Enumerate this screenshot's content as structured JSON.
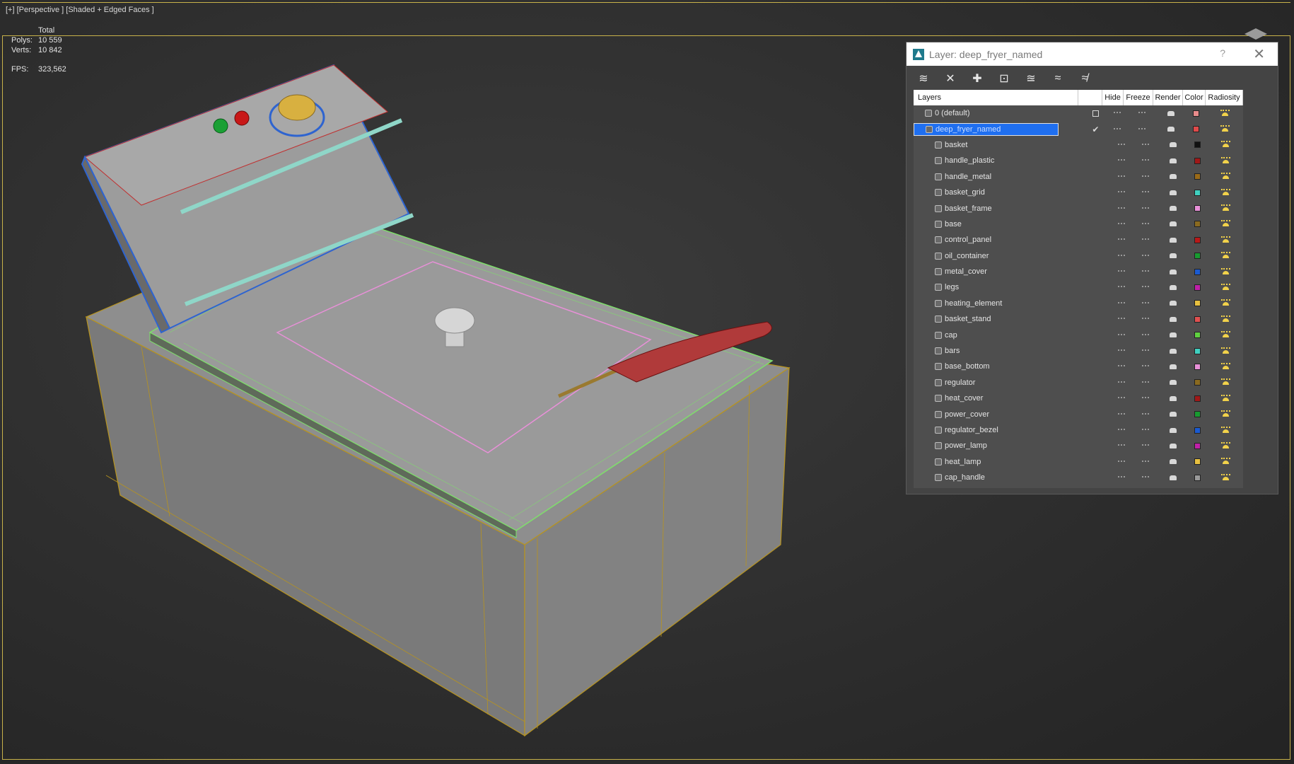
{
  "viewport": {
    "label": "[+] [Perspective ] [Shaded + Edged Faces ]",
    "stats": {
      "total_label": "Total",
      "polys_label": "Polys:",
      "polys_value": "10 559",
      "verts_label": "Verts:",
      "verts_value": "10 842",
      "fps_label": "FPS:",
      "fps_value": "323,562"
    }
  },
  "dialog": {
    "title": "Layer: deep_fryer_named",
    "help": "?",
    "close": "✕",
    "columns": {
      "layers": "Layers",
      "hide": "Hide",
      "freeze": "Freeze",
      "render": "Render",
      "color": "Color",
      "radiosity": "Radiosity"
    },
    "layers": [
      {
        "name": "0 (default)",
        "level": 0,
        "color": "#e88c8c",
        "checkbox": true
      },
      {
        "name": "deep_fryer_named",
        "level": 0,
        "color": "#e04a4a",
        "selected": true,
        "active": true
      },
      {
        "name": "basket",
        "level": 1,
        "color": "#111111"
      },
      {
        "name": "handle_plastic",
        "level": 1,
        "color": "#a01818"
      },
      {
        "name": "handle_metal",
        "level": 1,
        "color": "#9a6a18"
      },
      {
        "name": "basket_grid",
        "level": 1,
        "color": "#40d0c0"
      },
      {
        "name": "basket_frame",
        "level": 1,
        "color": "#e890d8"
      },
      {
        "name": "base",
        "level": 1,
        "color": "#8a6a20"
      },
      {
        "name": "control_panel",
        "level": 1,
        "color": "#b81818"
      },
      {
        "name": "oil_container",
        "level": 1,
        "color": "#189a30"
      },
      {
        "name": "metal_cover",
        "level": 1,
        "color": "#1a5ad0"
      },
      {
        "name": "legs",
        "level": 1,
        "color": "#c020a8"
      },
      {
        "name": "heating_element",
        "level": 1,
        "color": "#e8c040"
      },
      {
        "name": "basket_stand",
        "level": 1,
        "color": "#e05050"
      },
      {
        "name": "cap",
        "level": 1,
        "color": "#60d040"
      },
      {
        "name": "bars",
        "level": 1,
        "color": "#40d0c0"
      },
      {
        "name": "base_bottom",
        "level": 1,
        "color": "#e890d8"
      },
      {
        "name": "regulator",
        "level": 1,
        "color": "#8a6a20"
      },
      {
        "name": "heat_cover",
        "level": 1,
        "color": "#a01818"
      },
      {
        "name": "power_cover",
        "level": 1,
        "color": "#189a30"
      },
      {
        "name": "regulator_bezel",
        "level": 1,
        "color": "#1a5ad0"
      },
      {
        "name": "power_lamp",
        "level": 1,
        "color": "#c020a8"
      },
      {
        "name": "heat_lamp",
        "level": 1,
        "color": "#e8c040"
      },
      {
        "name": "cap_handle",
        "level": 1,
        "color": "#9a9a9a"
      }
    ]
  },
  "colors": {
    "viewport_border": "#c8b24a",
    "selection": "#1f6ff0",
    "stats_text": "#e6c84a"
  }
}
